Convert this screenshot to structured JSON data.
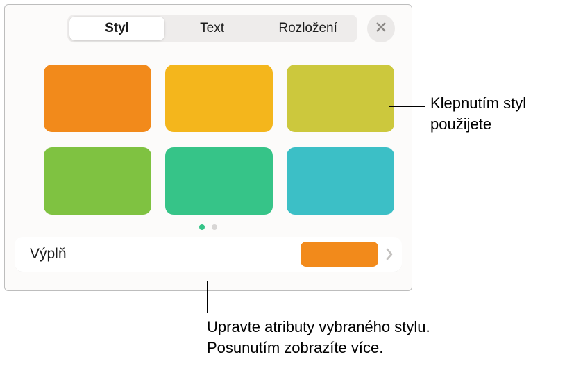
{
  "tabs": {
    "style": "Styl",
    "text": "Text",
    "layout": "Rozložení"
  },
  "swatches": {
    "c0": "#f28a1b",
    "c1": "#f4b61c",
    "c2": "#ccc83d",
    "c3": "#7fc241",
    "c4": "#36c488",
    "c5": "#3cbfc6"
  },
  "pager": {
    "active": "#36c488",
    "inactive": "#d8d6d5"
  },
  "fill": {
    "label": "Výplň",
    "previewColor": "#f28a1b"
  },
  "callouts": {
    "applyStyle": "Klepnutím styl použijete",
    "editAttrs": "Upravte atributy vybraného stylu. Posunutím zobrazíte více."
  },
  "colors": {
    "closeX": "#8a8784",
    "chevron": "#c3c1bf"
  }
}
